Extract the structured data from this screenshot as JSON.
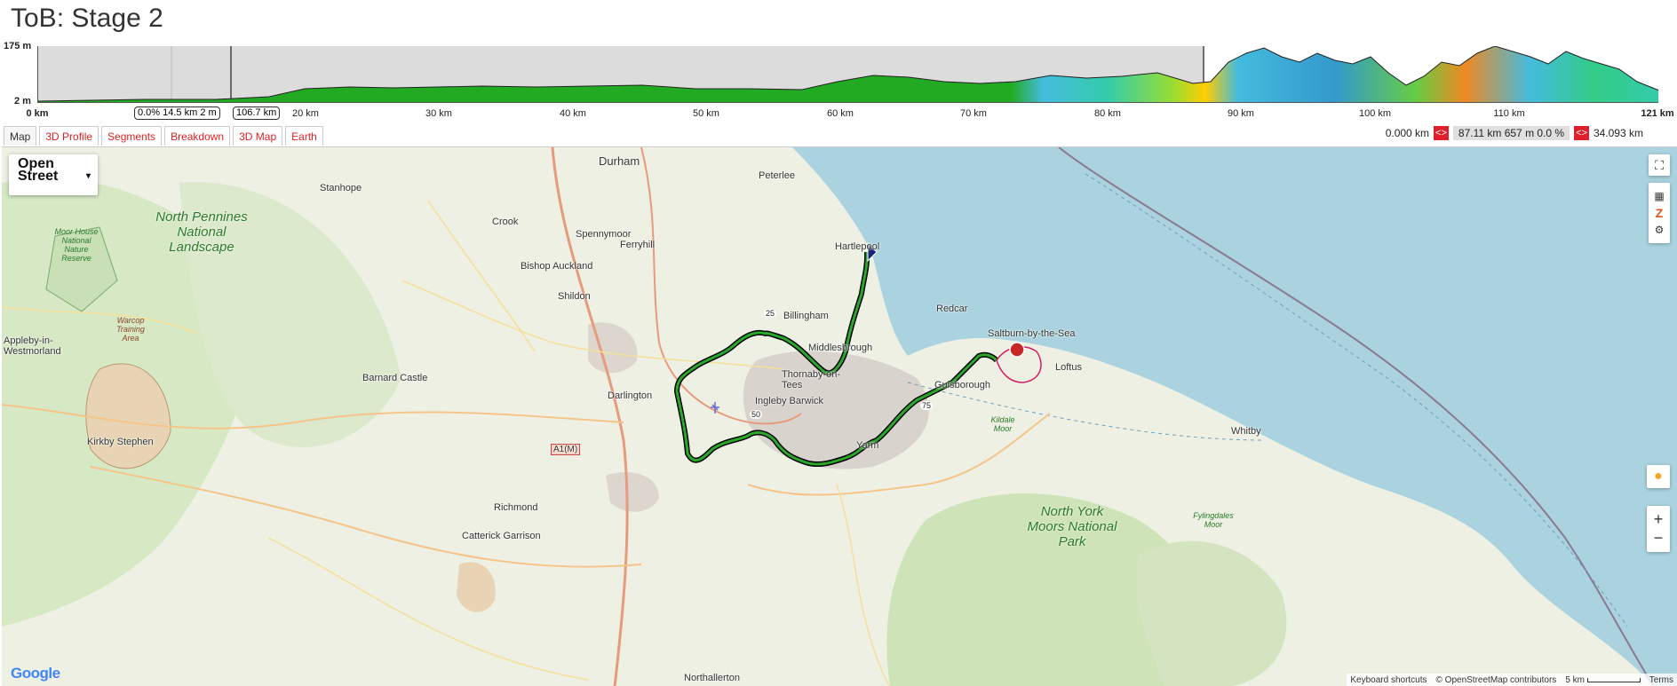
{
  "page": {
    "title": "ToB: Stage 2"
  },
  "profile": {
    "ymax_label": "175 m",
    "ymin_label": "2 m",
    "xticks": [
      "0 km",
      "20 km",
      "30 km",
      "40 km",
      "50 km",
      "60 km",
      "70 km",
      "80 km",
      "90 km",
      "100 km",
      "110 km",
      "121 km"
    ],
    "selection_info": "0.0% 14.5 km 2 m",
    "selection_end": "106.7 km"
  },
  "tabs": [
    {
      "label": "Map",
      "active": true
    },
    {
      "label": "3D Profile"
    },
    {
      "label": "Segments"
    },
    {
      "label": "Breakdown"
    },
    {
      "label": "3D Map"
    },
    {
      "label": "Earth"
    }
  ],
  "range": {
    "start": "0.000 km",
    "middle": "87.11 km 657 m 0.0 %",
    "end": "34.093 km",
    "arrows": "<>"
  },
  "map": {
    "layer_label": "Open Street",
    "places": [
      {
        "name": "Durham",
        "type": "city"
      },
      {
        "name": "Peterlee"
      },
      {
        "name": "Stanhope"
      },
      {
        "name": "Crook"
      },
      {
        "name": "Spennymoor"
      },
      {
        "name": "Ferryhill"
      },
      {
        "name": "Hartlepool"
      },
      {
        "name": "Bishop Auckland"
      },
      {
        "name": "Shildon"
      },
      {
        "name": "Billingham"
      },
      {
        "name": "Redcar"
      },
      {
        "name": "Middlesbrough"
      },
      {
        "name": "Saltburn-by-the-Sea"
      },
      {
        "name": "Appleby-in-Westmorland"
      },
      {
        "name": "Loftus"
      },
      {
        "name": "Barnard Castle"
      },
      {
        "name": "Darlington"
      },
      {
        "name": "Thornaby-on-Tees"
      },
      {
        "name": "Guisborough"
      },
      {
        "name": "Ingleby Barwick"
      },
      {
        "name": "Yarm"
      },
      {
        "name": "Kirkby Stephen"
      },
      {
        "name": "Whitby"
      },
      {
        "name": "Richmond"
      },
      {
        "name": "Catterick Garrison"
      },
      {
        "name": "Northallerton"
      },
      {
        "name": "A1(M)"
      },
      {
        "name": "Kildale Moor"
      },
      {
        "name": "Fylingdales Moor"
      },
      {
        "name": "Warcop Training Area"
      },
      {
        "name": "Moor House National Nature Reserve"
      }
    ],
    "parks": [
      "North Pennines National Landscape",
      "North York Moors National Park"
    ],
    "route_markers": [
      "25",
      "50",
      "75"
    ],
    "attribution": [
      "Keyboard shortcuts",
      "© OpenStreetMap contributors",
      "5 km",
      "Terms"
    ],
    "google": "Google",
    "colors": {
      "sea": "#aad3df",
      "route": "#1a8a1a",
      "start": "#1a237e",
      "finish": "#c62828"
    }
  }
}
